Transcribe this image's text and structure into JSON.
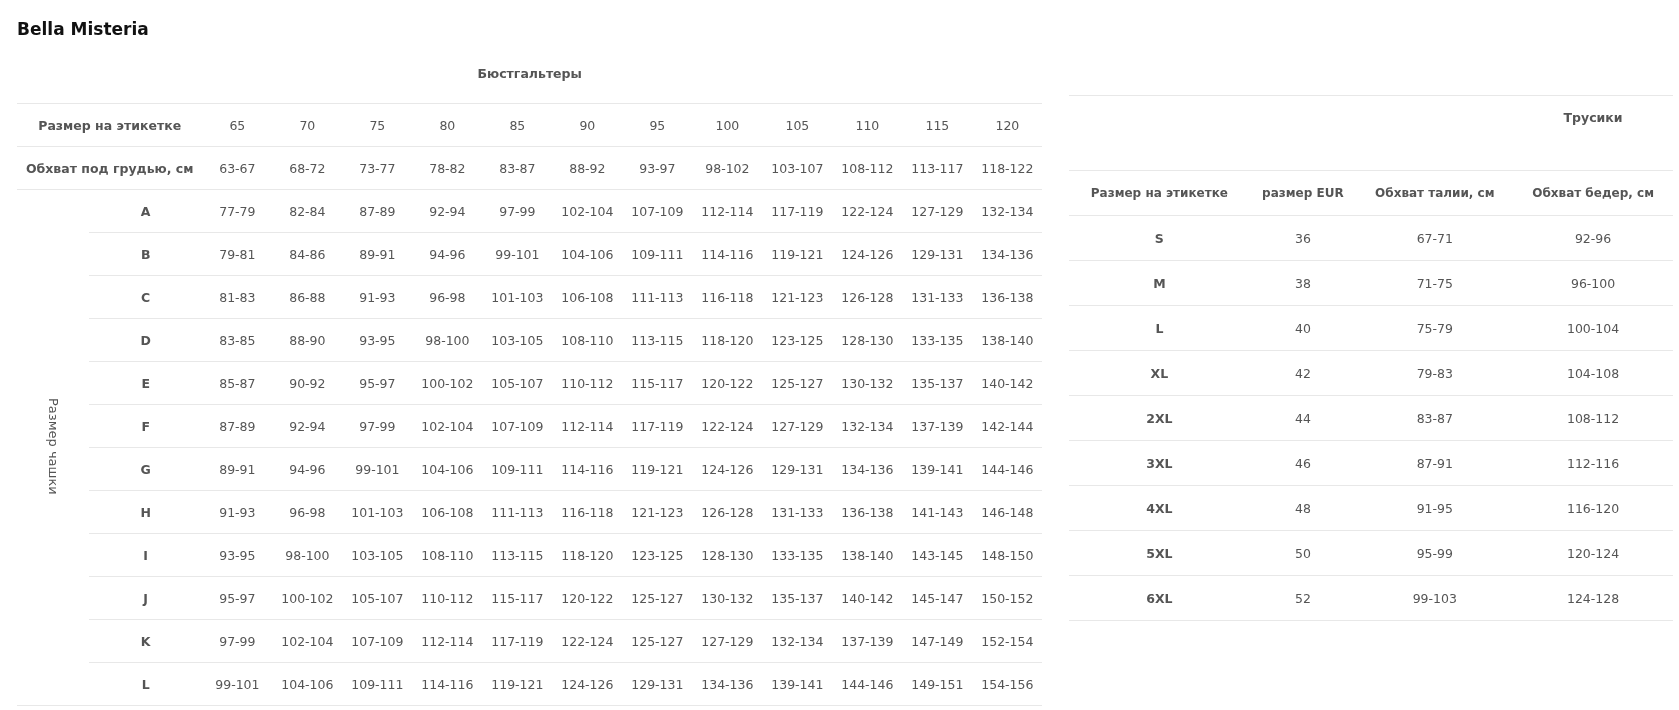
{
  "brand": "Bella Misteria",
  "bras": {
    "title": "Бюстгальтеры",
    "size_row": {
      "label": "Размер на этикетке",
      "values": [
        "65",
        "70",
        "75",
        "80",
        "85",
        "90",
        "95",
        "100",
        "105",
        "110",
        "115",
        "120"
      ]
    },
    "underbust_row": {
      "label": "Обхват под грудью, см",
      "values": [
        "63-67",
        "68-72",
        "73-77",
        "78-82",
        "83-87",
        "88-92",
        "93-97",
        "98-102",
        "103-107",
        "108-112",
        "113-117",
        "118-122"
      ]
    },
    "cup_label": "Размер чашки",
    "cup_rows": [
      {
        "cup": "A",
        "values": [
          "77-79",
          "82-84",
          "87-89",
          "92-94",
          "97-99",
          "102-104",
          "107-109",
          "112-114",
          "117-119",
          "122-124",
          "127-129",
          "132-134"
        ]
      },
      {
        "cup": "B",
        "values": [
          "79-81",
          "84-86",
          "89-91",
          "94-96",
          "99-101",
          "104-106",
          "109-111",
          "114-116",
          "119-121",
          "124-126",
          "129-131",
          "134-136"
        ]
      },
      {
        "cup": "C",
        "values": [
          "81-83",
          "86-88",
          "91-93",
          "96-98",
          "101-103",
          "106-108",
          "111-113",
          "116-118",
          "121-123",
          "126-128",
          "131-133",
          "136-138"
        ]
      },
      {
        "cup": "D",
        "values": [
          "83-85",
          "88-90",
          "93-95",
          "98-100",
          "103-105",
          "108-110",
          "113-115",
          "118-120",
          "123-125",
          "128-130",
          "133-135",
          "138-140"
        ]
      },
      {
        "cup": "E",
        "values": [
          "85-87",
          "90-92",
          "95-97",
          "100-102",
          "105-107",
          "110-112",
          "115-117",
          "120-122",
          "125-127",
          "130-132",
          "135-137",
          "140-142"
        ]
      },
      {
        "cup": "F",
        "values": [
          "87-89",
          "92-94",
          "97-99",
          "102-104",
          "107-109",
          "112-114",
          "117-119",
          "122-124",
          "127-129",
          "132-134",
          "137-139",
          "142-144"
        ]
      },
      {
        "cup": "G",
        "values": [
          "89-91",
          "94-96",
          "99-101",
          "104-106",
          "109-111",
          "114-116",
          "119-121",
          "124-126",
          "129-131",
          "134-136",
          "139-141",
          "144-146"
        ]
      },
      {
        "cup": "H",
        "values": [
          "91-93",
          "96-98",
          "101-103",
          "106-108",
          "111-113",
          "116-118",
          "121-123",
          "126-128",
          "131-133",
          "136-138",
          "141-143",
          "146-148"
        ]
      },
      {
        "cup": "I",
        "values": [
          "93-95",
          "98-100",
          "103-105",
          "108-110",
          "113-115",
          "118-120",
          "123-125",
          "128-130",
          "133-135",
          "138-140",
          "143-145",
          "148-150"
        ]
      },
      {
        "cup": "J",
        "values": [
          "95-97",
          "100-102",
          "105-107",
          "110-112",
          "115-117",
          "120-122",
          "125-127",
          "130-132",
          "135-137",
          "140-142",
          "145-147",
          "150-152"
        ]
      },
      {
        "cup": "K",
        "values": [
          "97-99",
          "102-104",
          "107-109",
          "112-114",
          "117-119",
          "122-124",
          "125-127",
          "127-129",
          "132-134",
          "137-139",
          "147-149",
          "152-154"
        ]
      },
      {
        "cup": "L",
        "values": [
          "99-101",
          "104-106",
          "109-111",
          "114-116",
          "119-121",
          "124-126",
          "129-131",
          "134-136",
          "139-141",
          "144-146",
          "149-151",
          "154-156"
        ]
      }
    ]
  },
  "panties": {
    "title": "Трусики",
    "columns": [
      "Размер на этикетке",
      "размер EUR",
      "Обхват талии, см",
      "Обхват бедер, см"
    ],
    "rows": [
      [
        "S",
        "36",
        "67-71",
        "92-96"
      ],
      [
        "M",
        "38",
        "71-75",
        "96-100"
      ],
      [
        "L",
        "40",
        "75-79",
        "100-104"
      ],
      [
        "XL",
        "42",
        "79-83",
        "104-108"
      ],
      [
        "2XL",
        "44",
        "83-87",
        "108-112"
      ],
      [
        "3XL",
        "46",
        "87-91",
        "112-116"
      ],
      [
        "4XL",
        "48",
        "91-95",
        "116-120"
      ],
      [
        "5XL",
        "50",
        "95-99",
        "120-124"
      ],
      [
        "6XL",
        "52",
        "99-103",
        "124-128"
      ]
    ]
  }
}
